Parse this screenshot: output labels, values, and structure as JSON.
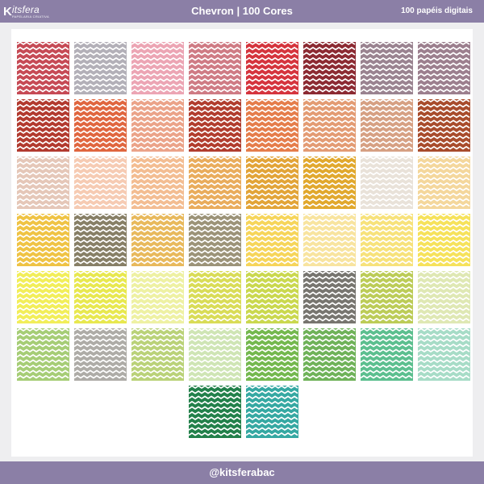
{
  "header": {
    "logo_mark": "K",
    "logo_text": "itsfera",
    "logo_tagline": "PAPELARIA CRIATIVA",
    "title": "Chevron | 100 Cores",
    "count_label": "100 papéis digitais"
  },
  "footer": {
    "handle": "@kitsferabac"
  },
  "swatches": [
    "#c64a55",
    "#b3b0b8",
    "#eca5b4",
    "#cf7b84",
    "#d5343d",
    "#8c2a32",
    "#9a8390",
    "#9c7f8e",
    "#b23a2f",
    "#e0663f",
    "#eba389",
    "#b13d2e",
    "#e57d4b",
    "#e39b73",
    "#d6a083",
    "#a84c2c",
    "#e5c7b8",
    "#f6cbb3",
    "#f3bd92",
    "#e9ac5c",
    "#e2a438",
    "#e1a82d",
    "#e9e2d9",
    "#f4d79c",
    "#efc344",
    "#877f66",
    "#e8b95c",
    "#9c9378",
    "#f6d55a",
    "#f8e49f",
    "#f7e27b",
    "#f6e25b",
    "#f2ee59",
    "#e8e84f",
    "#eef1a3",
    "#d9dc57",
    "#cad84e",
    "#77756f",
    "#bccc57",
    "#dfe8b4",
    "#a6cd76",
    "#aeaca7",
    "#bad279",
    "#cfe5b5",
    "#74b84e",
    "#6fb259",
    "#5cbf8f",
    "#a7dcc7",
    "#22804a",
    "#35a8a2"
  ]
}
